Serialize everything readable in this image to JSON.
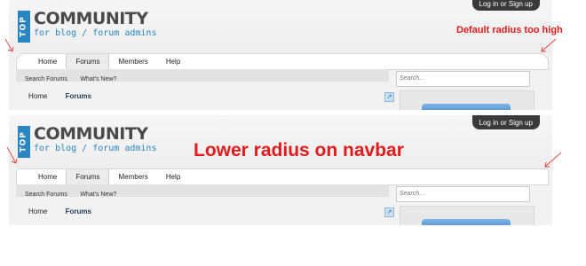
{
  "logo": {
    "vertical_text": "TOP",
    "name": "COMMUNITY",
    "tagline": "for blog / forum admins"
  },
  "login_label": "Log in or Sign up",
  "navbar": {
    "tabs": [
      {
        "label": "Home",
        "active": false
      },
      {
        "label": "Forums",
        "active": true
      },
      {
        "label": "Members",
        "active": false
      },
      {
        "label": "Help",
        "active": false
      }
    ]
  },
  "subnav": {
    "links": [
      "Search Forums",
      "What's New?"
    ]
  },
  "breadcrumbs": [
    "Home",
    "Forums"
  ],
  "search": {
    "placeholder": "Search..."
  },
  "annotations": {
    "top": "Default radius too high",
    "bottom": "Lower radius on navbar"
  },
  "colors": {
    "annotation": "#e21a1a",
    "logo_blue": "#2a86c1"
  }
}
